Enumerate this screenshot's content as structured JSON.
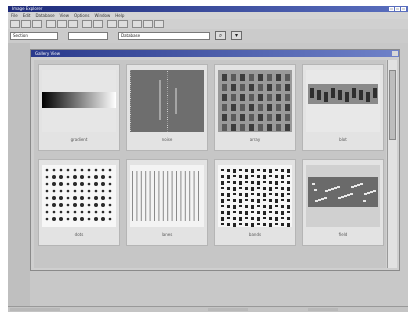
{
  "window": {
    "title": "Image Explorer"
  },
  "menu": [
    "File",
    "Edit",
    "Database",
    "View",
    "Options",
    "Window",
    "Help"
  ],
  "toolbar": {
    "field1": "Section",
    "field2": "",
    "field3": "Database"
  },
  "child_window": {
    "title": "Gallery View"
  },
  "gallery": [
    {
      "caption": "gradient",
      "kind": "gradient"
    },
    {
      "caption": "noise",
      "kind": "noise"
    },
    {
      "caption": "array",
      "kind": "array"
    },
    {
      "caption": "blot",
      "kind": "blot"
    },
    {
      "caption": "dots",
      "kind": "dots"
    },
    {
      "caption": "lanes",
      "kind": "lanes"
    },
    {
      "caption": "bands",
      "kind": "bands"
    },
    {
      "caption": "field",
      "kind": "field"
    }
  ]
}
